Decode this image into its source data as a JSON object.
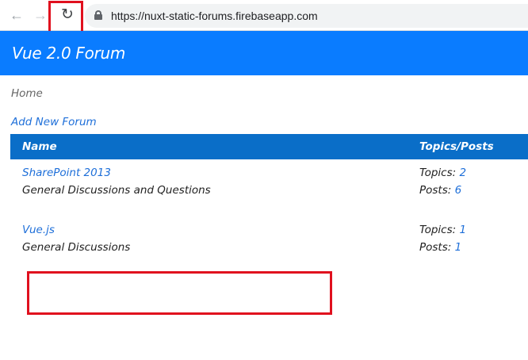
{
  "browser": {
    "url": "https://nuxt-static-forums.firebaseapp.com",
    "icons": {
      "back": "arrow-left-icon",
      "forward": "arrow-right-icon",
      "reload": "reload-icon",
      "lock": "lock-icon"
    }
  },
  "app": {
    "title": "Vue 2.0 Forum"
  },
  "breadcrumb": {
    "home": "Home"
  },
  "actions": {
    "add_forum": "Add New Forum"
  },
  "table": {
    "headers": {
      "name": "Name",
      "topics_posts": "Topics/Posts"
    },
    "rows": [
      {
        "name": "SharePoint 2013",
        "description": "General Discussions and Questions",
        "topics_label": "Topics:",
        "topics": "2",
        "posts_label": "Posts:",
        "posts": "6"
      },
      {
        "name": "Vue.js",
        "description": "General Discussions",
        "topics_label": "Topics:",
        "topics": "1",
        "posts_label": "Posts:",
        "posts": "1"
      }
    ]
  },
  "colors": {
    "header": "#0a7cff",
    "table_header": "#0a6ec8",
    "link": "#1e6fd9",
    "highlight": "#e0101e"
  }
}
